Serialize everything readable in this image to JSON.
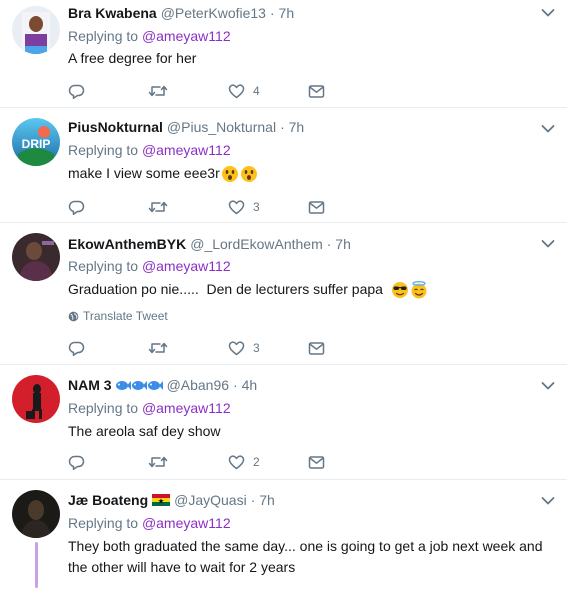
{
  "tweets": [
    {
      "name": "Bra Kwabena",
      "handle": "@PeterKwofie13",
      "time": "· 7h",
      "replying_prefix": "Replying to ",
      "replying_to": "@ameyaw112",
      "text": "A free degree for her",
      "likes": "4"
    },
    {
      "name": "PiusNokturnal",
      "handle": "@Pius_Nokturnal",
      "time": "· 7h",
      "replying_prefix": "Replying to ",
      "replying_to": "@ameyaw112",
      "text": "make I view some eee3r",
      "avatar_text": "DRIP",
      "likes": "3"
    },
    {
      "name": "EkowAnthemBYK",
      "handle": "@_LordEkowAnthem",
      "time": "· 7h",
      "replying_prefix": "Replying to ",
      "replying_to": "@ameyaw112",
      "text": "Graduation po nie.....  Den de lecturers suffer papa",
      "translate": "Translate Tweet",
      "likes": "3"
    },
    {
      "name": "NAM 3",
      "handle": "@Aban96",
      "time": "· 4h",
      "replying_prefix": "Replying to ",
      "replying_to": "@ameyaw112",
      "text": "The areola saf dey show",
      "likes": "2"
    },
    {
      "name": "Jæ Boateng",
      "handle": "@JayQuasi",
      "time": "· 7h",
      "replying_prefix": "Replying to ",
      "replying_to": "@ameyaw112",
      "text": "They both graduated the same day... one is going to get a job next week and the other will have to wait for 2 years"
    }
  ],
  "colors": {
    "mention": "#8b30c4",
    "muted": "#657786",
    "text": "#14171a",
    "divider": "#e6ecf0",
    "thread": "#c9a2e6"
  },
  "icons": [
    "reply-icon",
    "retweet-icon",
    "like-icon",
    "dm-icon",
    "chevron-down-icon",
    "globe-icon",
    "fish-emoji-icon",
    "ghana-flag-icon"
  ]
}
